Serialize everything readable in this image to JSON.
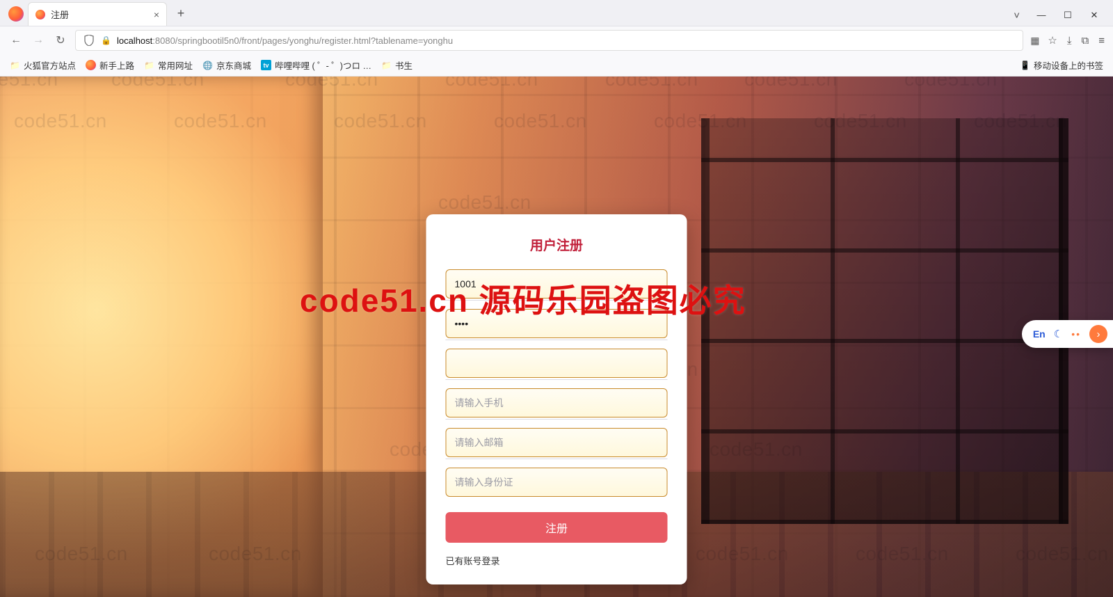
{
  "browser": {
    "tab_title": "注册",
    "url_host": "localhost",
    "url_rest": ":8080/springbootil5n0/front/pages/yonghu/register.html?tablename=yonghu",
    "window": {
      "v": "˅",
      "min": "—",
      "max": "☐",
      "close": "✕"
    },
    "newtab": "+"
  },
  "bookmarks": {
    "items": [
      {
        "label": "火狐官方站点",
        "icon": "folder"
      },
      {
        "label": "新手上路",
        "icon": "fox"
      },
      {
        "label": "常用网址",
        "icon": "folder"
      },
      {
        "label": "京东商城",
        "icon": "globe"
      },
      {
        "label": "哔哩哔哩 (  ゜- ゜)つロ …",
        "icon": "bili"
      },
      {
        "label": "书生",
        "icon": "folder"
      }
    ],
    "right": {
      "label": "移动设备上的书签",
      "icon": "mobile"
    }
  },
  "watermark": {
    "text": "code51.cn",
    "red": "code51.cn 源码乐园盗图必究"
  },
  "form": {
    "title": "用户注册",
    "fields": [
      {
        "value": "1001",
        "placeholder": ""
      },
      {
        "value": "••••",
        "placeholder": ""
      },
      {
        "value": "",
        "placeholder": ""
      },
      {
        "value": "",
        "placeholder": "请输入手机"
      },
      {
        "value": "",
        "placeholder": "请输入邮箱"
      },
      {
        "value": "",
        "placeholder": "请输入身份证"
      }
    ],
    "submit": "注册",
    "login_link": "已有账号登录"
  },
  "float": {
    "en": "En",
    "moon": "☾",
    "dots": "••",
    "arrow": "›"
  }
}
